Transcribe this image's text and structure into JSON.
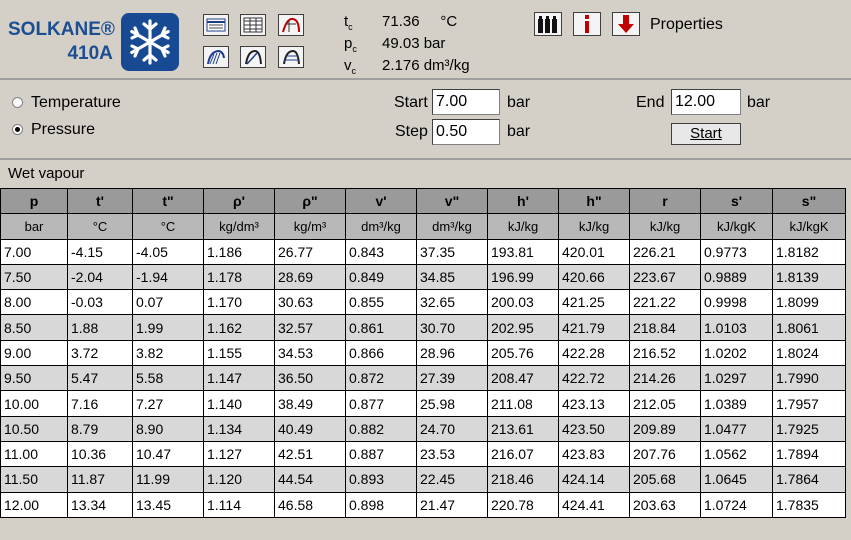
{
  "logo": {
    "brand": "SOLKANE®",
    "model": "410A"
  },
  "toolbar": {
    "buttons": [
      {
        "name": "table-view-icon"
      },
      {
        "name": "grid-view-icon"
      },
      {
        "name": "curve-icon"
      },
      {
        "name": "diagram-ph-icon"
      },
      {
        "name": "diagram-ts-icon"
      },
      {
        "name": "diagram-hs-icon"
      }
    ]
  },
  "critical": [
    {
      "sym": "t",
      "sub": "c",
      "value": "71.36",
      "unit": "°C"
    },
    {
      "sym": "p",
      "sub": "c",
      "value": "49.03",
      "unit": "bar"
    },
    {
      "sym": "v",
      "sub": "c",
      "value": "2.176",
      "unit": "dm³/kg"
    }
  ],
  "properties": {
    "label": "Properties"
  },
  "controls": {
    "temperature_label": "Temperature",
    "pressure_label": "Pressure",
    "selected": "Pressure",
    "start_label": "Start",
    "start_value": "7.00",
    "start_unit": "bar",
    "step_label": "Step",
    "step_value": "0.50",
    "step_unit": "bar",
    "end_label": "End",
    "end_value": "12.00",
    "end_unit": "bar",
    "start_button": "Start"
  },
  "section": {
    "title": "Wet vapour"
  },
  "table": {
    "symbols": [
      "p",
      "t'",
      "t\"",
      "ρ'",
      "ρ\"",
      "v'",
      "v\"",
      "h'",
      "h\"",
      "r",
      "s'",
      "s\""
    ],
    "units": [
      "bar",
      "°C",
      "°C",
      "kg/dm³",
      "kg/m³",
      "dm³/kg",
      "dm³/kg",
      "kJ/kg",
      "kJ/kg",
      "kJ/kg",
      "kJ/kgK",
      "kJ/kgK"
    ],
    "rows": [
      [
        "7.00",
        "-4.15",
        "-4.05",
        "1.186",
        "26.77",
        "0.843",
        "37.35",
        "193.81",
        "420.01",
        "226.21",
        "0.9773",
        "1.8182"
      ],
      [
        "7.50",
        "-2.04",
        "-1.94",
        "1.178",
        "28.69",
        "0.849",
        "34.85",
        "196.99",
        "420.66",
        "223.67",
        "0.9889",
        "1.8139"
      ],
      [
        "8.00",
        "-0.03",
        "0.07",
        "1.170",
        "30.63",
        "0.855",
        "32.65",
        "200.03",
        "421.25",
        "221.22",
        "0.9998",
        "1.8099"
      ],
      [
        "8.50",
        "1.88",
        "1.99",
        "1.162",
        "32.57",
        "0.861",
        "30.70",
        "202.95",
        "421.79",
        "218.84",
        "1.0103",
        "1.8061"
      ],
      [
        "9.00",
        "3.72",
        "3.82",
        "1.155",
        "34.53",
        "0.866",
        "28.96",
        "205.76",
        "422.28",
        "216.52",
        "1.0202",
        "1.8024"
      ],
      [
        "9.50",
        "5.47",
        "5.58",
        "1.147",
        "36.50",
        "0.872",
        "27.39",
        "208.47",
        "422.72",
        "214.26",
        "1.0297",
        "1.7990"
      ],
      [
        "10.00",
        "7.16",
        "7.27",
        "1.140",
        "38.49",
        "0.877",
        "25.98",
        "211.08",
        "423.13",
        "212.05",
        "1.0389",
        "1.7957"
      ],
      [
        "10.50",
        "8.79",
        "8.90",
        "1.134",
        "40.49",
        "0.882",
        "24.70",
        "213.61",
        "423.50",
        "209.89",
        "1.0477",
        "1.7925"
      ],
      [
        "11.00",
        "10.36",
        "10.47",
        "1.127",
        "42.51",
        "0.887",
        "23.53",
        "216.07",
        "423.83",
        "207.76",
        "1.0562",
        "1.7894"
      ],
      [
        "11.50",
        "11.87",
        "11.99",
        "1.120",
        "44.54",
        "0.893",
        "22.45",
        "218.46",
        "424.14",
        "205.68",
        "1.0645",
        "1.7864"
      ],
      [
        "12.00",
        "13.34",
        "13.45",
        "1.114",
        "46.58",
        "0.898",
        "21.47",
        "220.78",
        "424.41",
        "203.63",
        "1.0724",
        "1.7835"
      ]
    ]
  }
}
